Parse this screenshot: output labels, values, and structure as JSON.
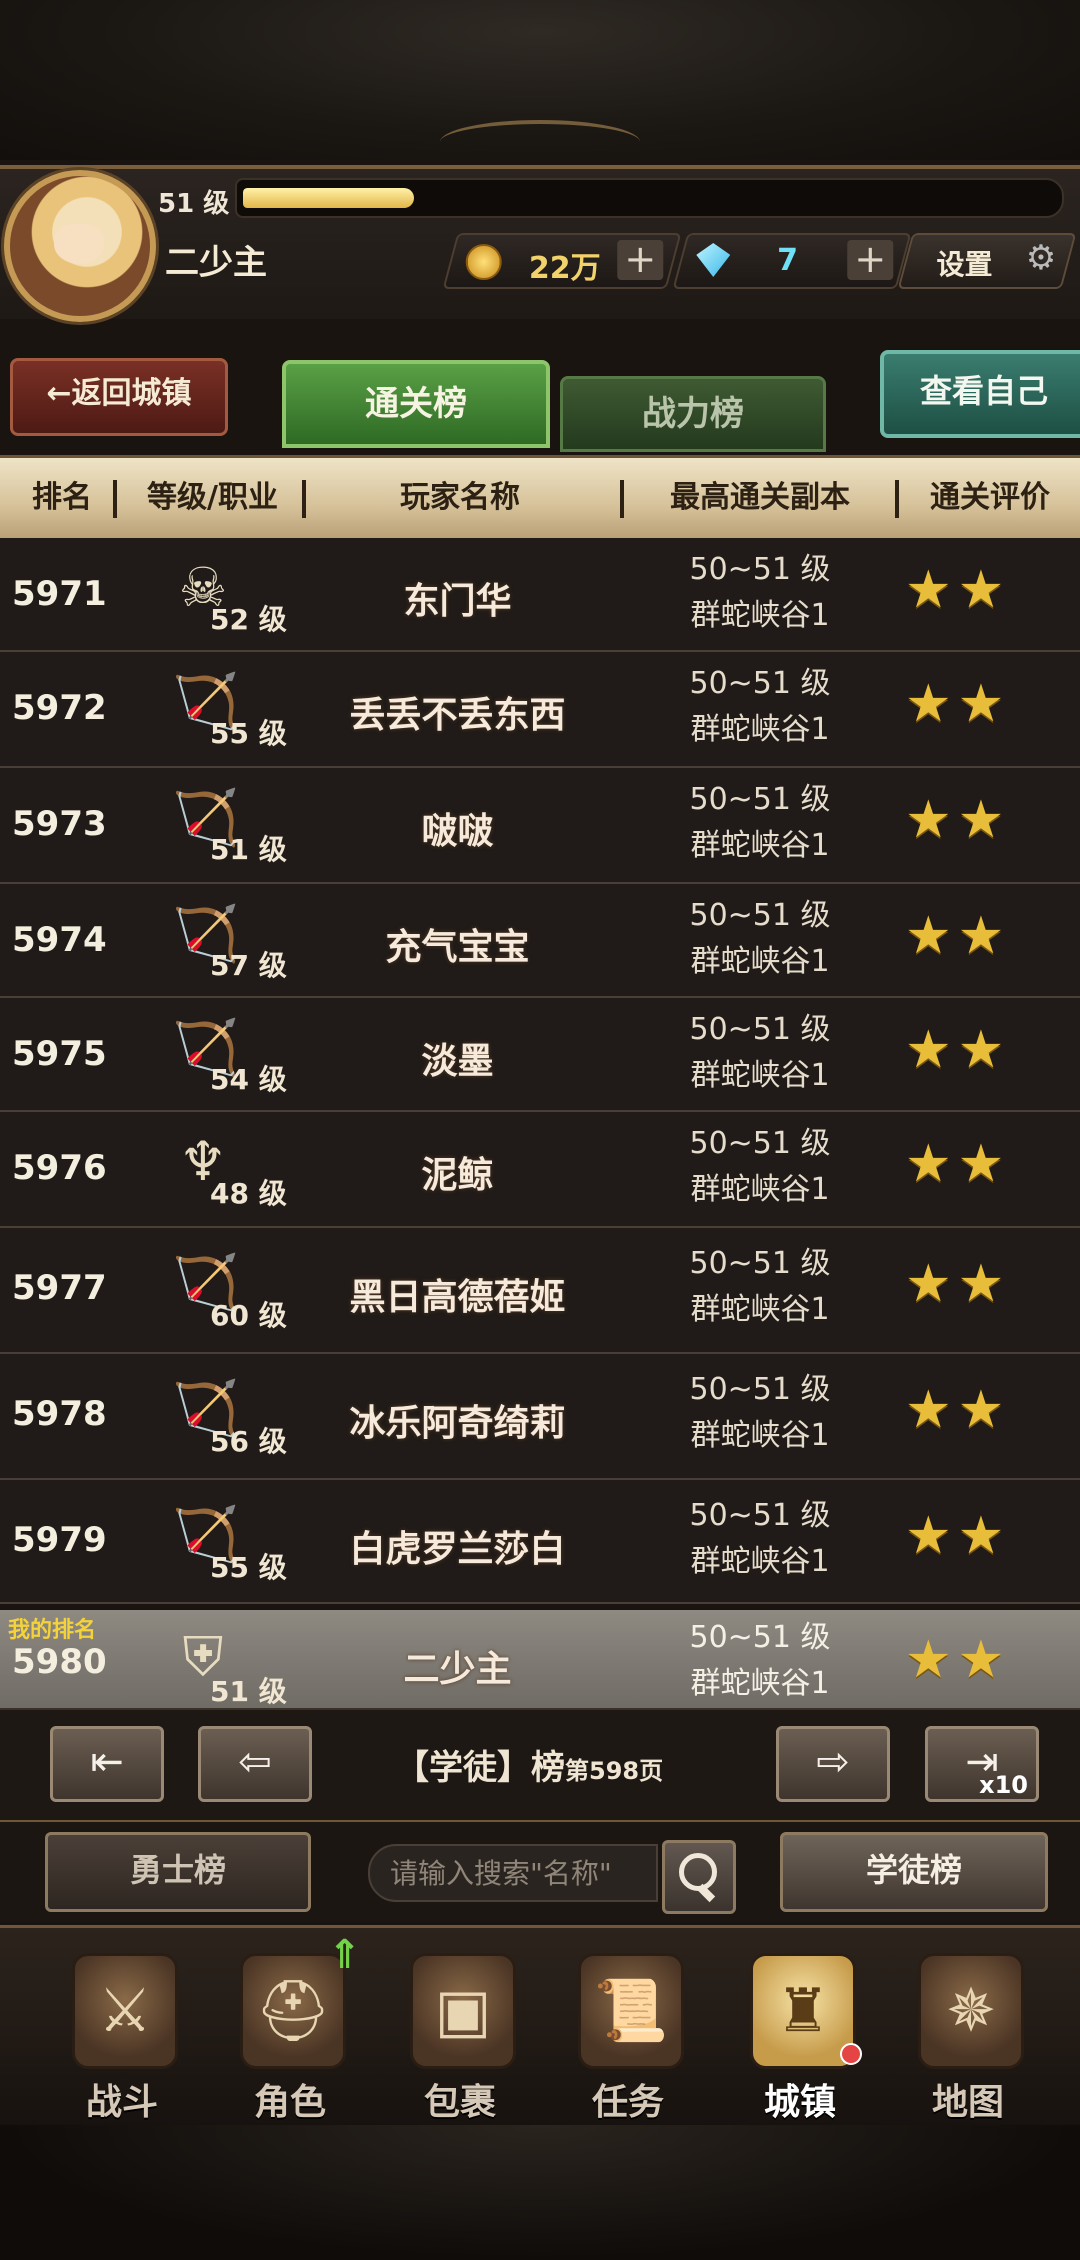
{
  "player": {
    "level_label": "51 级",
    "name": "二少主",
    "xp_fraction": 0.21
  },
  "currency": {
    "gold": "22万",
    "gems": "7",
    "plus": "+"
  },
  "settings_label": "设置",
  "back_label": "←返回城镇",
  "tabs": [
    {
      "label": "通关榜",
      "active": true
    },
    {
      "label": "战力榜",
      "active": false
    }
  ],
  "view_self_label": "查看自己",
  "columns": [
    "排名",
    "等级/职业",
    "玩家名称",
    "最高通关副本",
    "通关评价"
  ],
  "rows": [
    {
      "rank": "5971",
      "class_icon": "skull-staff-icon",
      "level": "52 级",
      "name": "东门华",
      "range": "50~51 级",
      "dungeon": "群蛇峡谷1",
      "stars": "★★"
    },
    {
      "rank": "5972",
      "class_icon": "bow-icon",
      "level": "55 级",
      "name": "丢丢不丢东西",
      "range": "50~51 级",
      "dungeon": "群蛇峡谷1",
      "stars": "★★"
    },
    {
      "rank": "5973",
      "class_icon": "bow-icon",
      "level": "51 级",
      "name": "啵啵",
      "range": "50~51 级",
      "dungeon": "群蛇峡谷1",
      "stars": "★★"
    },
    {
      "rank": "5974",
      "class_icon": "bow-icon",
      "level": "57 级",
      "name": "充气宝宝",
      "range": "50~51 级",
      "dungeon": "群蛇峡谷1",
      "stars": "★★"
    },
    {
      "rank": "5975",
      "class_icon": "bow-icon",
      "level": "54 级",
      "name": "淡墨",
      "range": "50~51 级",
      "dungeon": "群蛇峡谷1",
      "stars": "★★"
    },
    {
      "rank": "5976",
      "class_icon": "flame-emblem-icon",
      "level": "48 级",
      "name": "泥鲸",
      "range": "50~51 级",
      "dungeon": "群蛇峡谷1",
      "stars": "★★"
    },
    {
      "rank": "5977",
      "class_icon": "bow-icon",
      "level": "60 级",
      "name": "黑日高德蓓姬",
      "range": "50~51 级",
      "dungeon": "群蛇峡谷1",
      "stars": "★★"
    },
    {
      "rank": "5978",
      "class_icon": "bow-icon",
      "level": "56 级",
      "name": "冰乐阿奇绮莉",
      "range": "50~51 级",
      "dungeon": "群蛇峡谷1",
      "stars": "★★"
    },
    {
      "rank": "5979",
      "class_icon": "bow-icon",
      "level": "55 级",
      "name": "白虎罗兰莎白",
      "range": "50~51 级",
      "dungeon": "群蛇峡谷1",
      "stars": "★★"
    }
  ],
  "my_row": {
    "tag": "我的排名",
    "rank": "5980",
    "class_icon": "shield-cross-icon",
    "level": "51 级",
    "name": "二少主",
    "range": "50~51 级",
    "dungeon": "群蛇峡谷1",
    "stars": "★★"
  },
  "pager": {
    "label": "【学徒】榜",
    "page": "第598页",
    "x10": "x10"
  },
  "warrior_board_label": "勇士榜",
  "search_placeholder": "请输入搜索\"名称\"",
  "apprentice_board_label": "学徒榜",
  "nav": [
    {
      "label": "战斗",
      "icon": "crossed-swords-icon"
    },
    {
      "label": "角色",
      "icon": "helmet-icon"
    },
    {
      "label": "包裹",
      "icon": "backpack-icon"
    },
    {
      "label": "任务",
      "icon": "scroll-icon"
    },
    {
      "label": "城镇",
      "icon": "castle-tower-icon",
      "active": true
    },
    {
      "label": "地图",
      "icon": "map-icon"
    }
  ]
}
